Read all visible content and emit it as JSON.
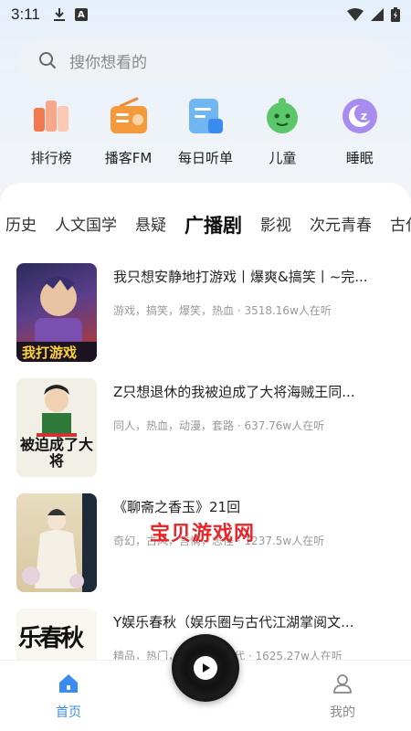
{
  "status_bar": {
    "time": "3:11",
    "icons": [
      "download-icon",
      "a-icon",
      "wifi-icon",
      "signal-icon",
      "battery-icon"
    ]
  },
  "search": {
    "placeholder": "搜你想看的"
  },
  "categories": [
    {
      "label": "排行榜",
      "icon": "ranking-icon"
    },
    {
      "label": "播客FM",
      "icon": "radio-icon"
    },
    {
      "label": "每日听单",
      "icon": "playlist-icon"
    },
    {
      "label": "儿童",
      "icon": "kids-icon"
    },
    {
      "label": "睡眠",
      "icon": "sleep-icon"
    }
  ],
  "tabs": [
    {
      "label": "历史"
    },
    {
      "label": "人文国学"
    },
    {
      "label": "悬疑"
    },
    {
      "label": "广播剧",
      "active": true
    },
    {
      "label": "影视"
    },
    {
      "label": "次元青春"
    },
    {
      "label": "古代"
    }
  ],
  "list": [
    {
      "title": "我只想安静地打游戏丨爆爽&搞笑丨~完...",
      "meta": "游戏，搞笑，爆笑，热血 · 3518.16w人在听",
      "cover_text": "我打游戏"
    },
    {
      "title": "Z只想退休的我被迫成了大将海贼王同...",
      "meta": "同人，热血，动漫，套路 · 637.76w人在听",
      "cover_text": "被迫成了大将"
    },
    {
      "title": "《聊斋之香玉》21回",
      "meta": "奇幻，古风，言情，志怪 · 1237.5w人在听",
      "cover_text": ""
    },
    {
      "title": "Y娱乐春秋（娱乐圈与古代江湖掌阅文...",
      "meta": "精品，热门，娱乐圈，古代 · 1625.27w人在听",
      "cover_text": "乐春秋"
    }
  ],
  "watermark": "宝贝游戏网",
  "bottom_nav": {
    "home_label": "首页",
    "mine_label": "我的"
  },
  "colors": {
    "accent": "#3b8cf0",
    "watermark": "#e8262a"
  }
}
